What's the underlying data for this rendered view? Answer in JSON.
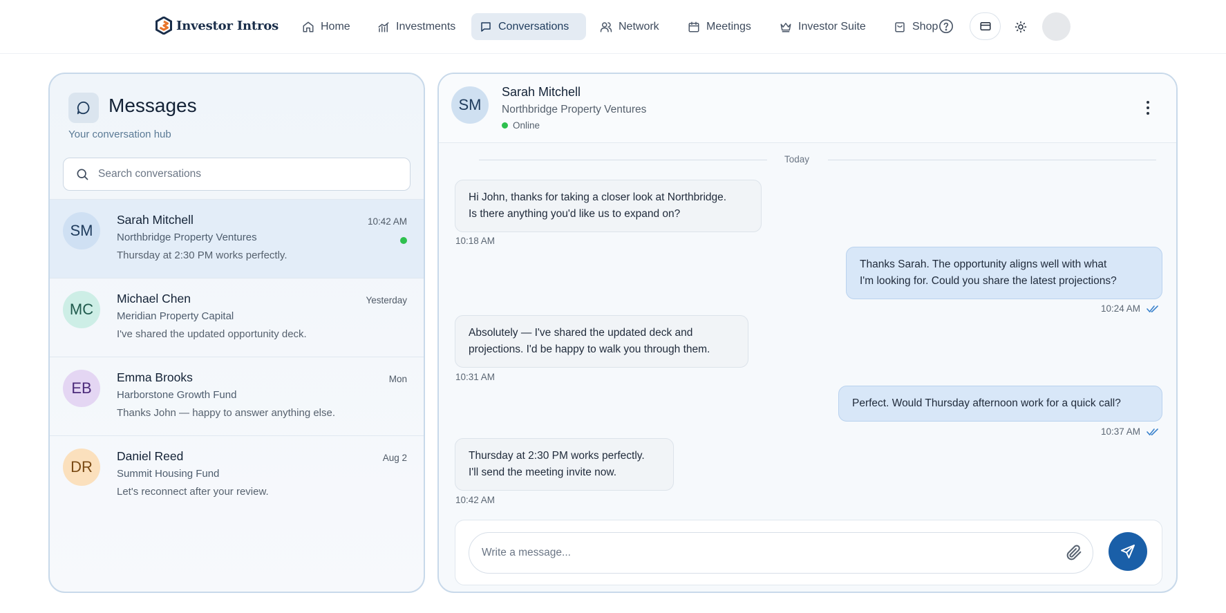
{
  "app": {
    "name": "Investor Intros",
    "brand_color": "#1a5fa8",
    "logo_icon": "hexagon-logo-icon"
  },
  "nav": {
    "items": [
      {
        "label": "Home",
        "icon": "home-icon"
      },
      {
        "label": "Investments",
        "icon": "chart-icon"
      },
      {
        "label": "Conversations",
        "icon": "chat-icon",
        "active": true
      },
      {
        "label": "Network",
        "icon": "users-icon"
      },
      {
        "label": "Meetings",
        "icon": "calendar-icon"
      },
      {
        "label": "Investor Suite",
        "icon": "crown-icon"
      },
      {
        "label": "Shop",
        "icon": "shopping-bag-icon"
      }
    ],
    "utility_icons": [
      "help-icon",
      "credit-card-icon",
      "sun-icon",
      "profile-avatar"
    ]
  },
  "sidebar": {
    "title": "Messages",
    "subtitle": "Your conversation hub",
    "search_placeholder": "Search conversations",
    "conversations": [
      {
        "initials": "SM",
        "name": "Sarah Mitchell",
        "company": "Northbridge Property Ventures",
        "preview": "Thursday at 2:30 PM works perfectly.",
        "time": "10:42 AM",
        "online": true,
        "active": true,
        "avatar_bg": "#cfe0f3",
        "avatar_fg": "#1e3b5c"
      },
      {
        "initials": "MC",
        "name": "Michael Chen",
        "company": "Meridian Property Capital",
        "preview": "I've shared the updated opportunity deck.",
        "time": "Yesterday",
        "online": false,
        "active": false,
        "avatar_bg": "#cdeee6",
        "avatar_fg": "#1f5a4c"
      },
      {
        "initials": "EB",
        "name": "Emma Brooks",
        "company": "Harborstone Growth Fund",
        "preview": "Thanks John — happy to answer anything else.",
        "time": "Mon",
        "online": false,
        "active": false,
        "avatar_bg": "#e4d6f3",
        "avatar_fg": "#4b2a7a"
      },
      {
        "initials": "DR",
        "name": "Daniel Reed",
        "company": "Summit Housing Fund",
        "preview": "Let's reconnect after your review.",
        "time": "Aug 2",
        "online": false,
        "active": false,
        "avatar_bg": "#fbe0bd",
        "avatar_fg": "#7a4a14"
      }
    ]
  },
  "chat": {
    "contact": {
      "initials": "SM",
      "name": "Sarah Mitchell",
      "company": "Northbridge Property Ventures",
      "status": "Online"
    },
    "day_label": "Today",
    "messages": [
      {
        "direction": "in",
        "lines": [
          "Hi John, thanks for taking a closer look at Northbridge.",
          "Is there anything you'd like us to expand on?"
        ],
        "time": "10:18 AM"
      },
      {
        "direction": "out",
        "lines": [
          "Thanks Sarah. The opportunity aligns well with what",
          "I'm looking for. Could you share the latest projections?"
        ],
        "time": "10:24 AM",
        "read": true
      },
      {
        "direction": "in",
        "lines": [
          "Absolutely — I've shared the updated deck and",
          "projections. I'd be happy to walk you through them."
        ],
        "time": "10:31 AM"
      },
      {
        "direction": "out",
        "lines": [
          "Perfect. Would Thursday afternoon work for a quick call?"
        ],
        "time": "10:37 AM",
        "read": true
      },
      {
        "direction": "in",
        "lines": [
          "Thursday at 2:30 PM works perfectly.",
          "I'll send the meeting invite now."
        ],
        "time": "10:42 AM"
      }
    ],
    "composer_placeholder": "Write a message..."
  }
}
